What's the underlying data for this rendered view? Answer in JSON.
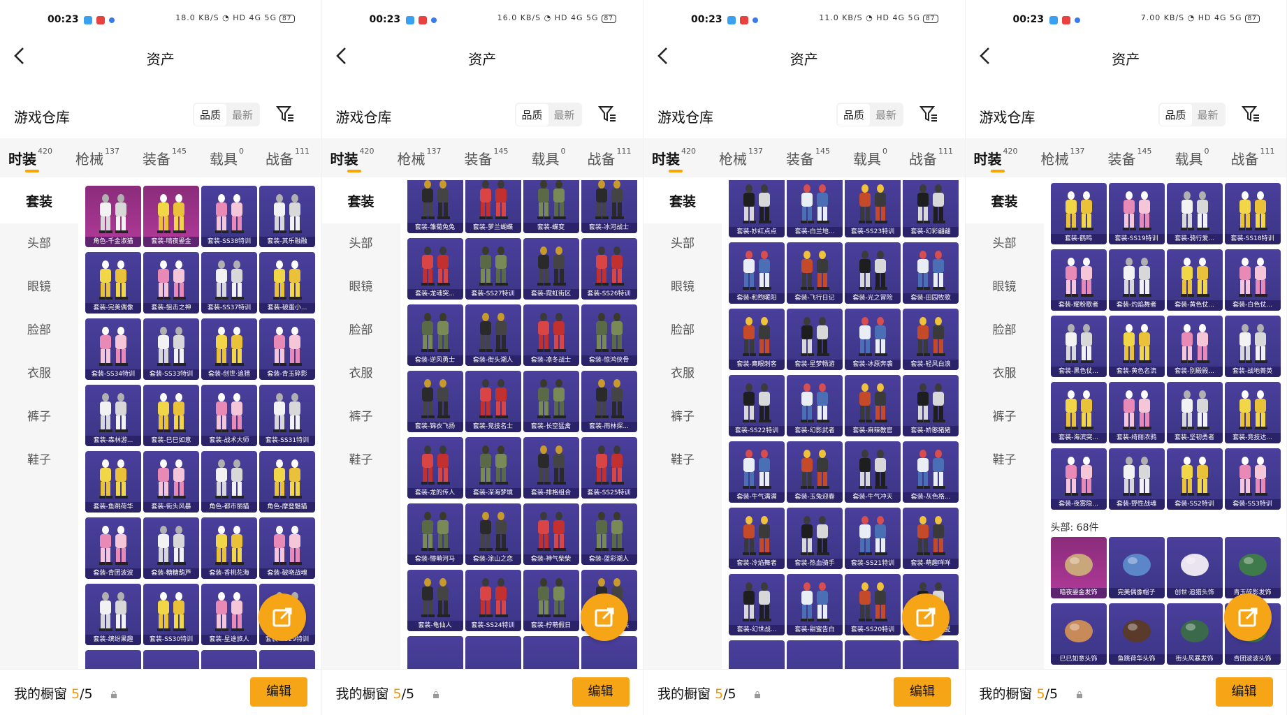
{
  "status": {
    "time": "00:23",
    "net_speeds": [
      "18.0 KB/S",
      "16.0 KB/S",
      "11.0 KB/S",
      "7.00 KB/S"
    ],
    "signal": "HD 4G 5G",
    "battery": "87"
  },
  "nav": {
    "title": "资产"
  },
  "header": {
    "title": "游戏仓库",
    "sort_quality": "品质",
    "sort_newest": "最新"
  },
  "tabs": [
    {
      "label": "时装",
      "count": "420"
    },
    {
      "label": "枪械",
      "count": "137"
    },
    {
      "label": "装备",
      "count": "145"
    },
    {
      "label": "载具",
      "count": "0"
    },
    {
      "label": "战备",
      "count": "111"
    }
  ],
  "sidebar": [
    "套装",
    "头部",
    "眼镜",
    "脸部",
    "衣服",
    "裤子",
    "鞋子"
  ],
  "panels": [
    {
      "items": [
        "角色-千金淑猫",
        "套装-晴夜鎏金",
        "套装-SS38特训",
        "套装-其乐融融",
        "套装-完美偶像",
        "套装-狙击之神",
        "套装-SS37特训",
        "套装-破蛋小...",
        "套装-SS34特训",
        "套装-SS33特训",
        "套装-创世·追猎",
        "套装-青玉碎影",
        "套装-森林游...",
        "套装-巳巳如意",
        "套装-战术大师",
        "套装-SS31特训",
        "套装-鱼跳荷华",
        "套装-街头风暴",
        "角色-都市丽猫",
        "角色-摩登魅猫",
        "套装-青团波波",
        "套装-糖糖葫芦",
        "套装-香桃花海",
        "套装-破晓战魂",
        "套装-缤纷果趣",
        "套装-SS30特训",
        "套装-星途旅人",
        "套装-SS29特训"
      ]
    },
    {
      "items": [
        "套装-雏菊兔兔",
        "套装-萝兰蝴蝶",
        "套装-蝶变",
        "套装-冰河战士",
        "套装-龙魂突...",
        "套装-SS27特训",
        "套装-霓虹街区",
        "套装-SS26特训",
        "套装-逆风勇士",
        "套装-街头潮人",
        "套装-凛冬战士",
        "套装-惊鸿侠骨",
        "套装-锦衣飞扬",
        "套装-竞技名士",
        "套装-长空猛禽",
        "套装-雨林探...",
        "套装-龙的传人",
        "套装-深海梦境",
        "套装-排格组合",
        "套装-SS25特训",
        "套装-懵萌河马",
        "套装-涂山之恋",
        "套装-神气柴柴",
        "套装-蓝彩潮人",
        "套装-龟仙人",
        "套装-SS24特训",
        "套装-柠萌假日",
        "套装-胡桃卫兵"
      ]
    },
    {
      "items": [
        "套装-妙红点点",
        "套装-白兰地...",
        "套装-SS23特训",
        "套装-幻彩翩翩",
        "套装-和煦暖阳",
        "套装-飞行日记",
        "套装-光之冒险",
        "套装-田园牧歌",
        "套装-鹰眼刺客",
        "套装-星梦畅游",
        "套装-冰原奔袭",
        "套装-轻风白浪",
        "套装-SS22特训",
        "套装-幻影武者",
        "套装-麻辣教官",
        "套装-娇憨猪猪",
        "套装-牛气满满",
        "套装-玉兔迎春",
        "套装-牛气冲天",
        "套装-灰色格...",
        "套装-冷焰舞者",
        "套装-热血骑手",
        "套装-SS21特训",
        "套装-萌趣咩咩",
        "套装-幻世战...",
        "套装-甜蜜告白",
        "套装-SS20特训",
        "套装-嫁盛之夏"
      ]
    },
    {
      "items": [
        "套装-鹤鸣",
        "套装-SS19特训",
        "套装-骑行爱...",
        "套装-SS18特训",
        "套装-耀粉歌者",
        "套装-灼焰舞者",
        "套装-黄色仗...",
        "套装-白色仗...",
        "套装-黑色仗...",
        "套装-黄色名流",
        "套装-别殿殿...",
        "套装-战地菁英",
        "套装-海滨突...",
        "套装-绮丽浓鸦",
        "套装-坚韧勇者",
        "套装-竞技达...",
        "套装-夜雾隐...",
        "套装-野性战魂",
        "套装-SS2特训",
        "套装-SS3特训"
      ],
      "section": "头部: 68件",
      "heads": [
        "暗夜鎏金发饰",
        "完美偶像帽子",
        "创世·追猎头饰",
        "青玉碎影发饰",
        "巳巳如意头饰",
        "鱼跳荷华头饰",
        "街头风暴发饰",
        "青团波波头饰"
      ]
    }
  ],
  "bottom": {
    "label": "我的橱窗",
    "count": "5",
    "total": "/5",
    "edit": "编辑"
  },
  "colors": {
    "accent": "#f6a516",
    "card": "#3b3585",
    "card_top": "#4a3f9c",
    "legendary": "#b23a9a"
  }
}
